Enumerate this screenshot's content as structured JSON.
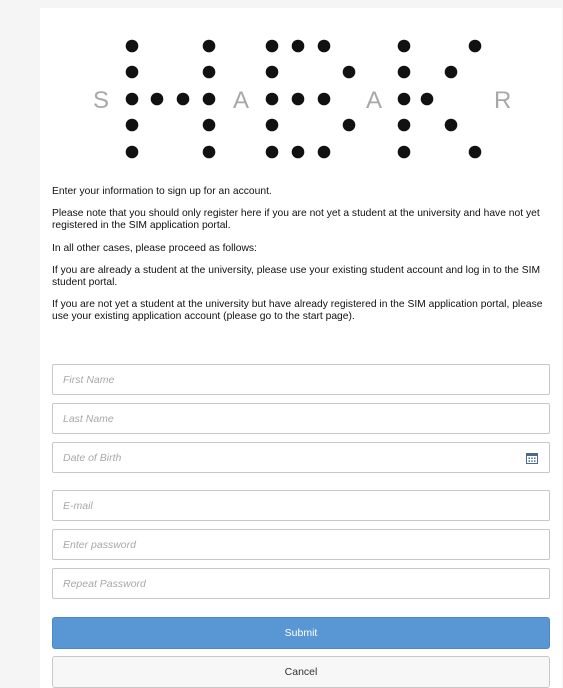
{
  "logo": {
    "letters": [
      "S",
      "A",
      "A",
      "R"
    ]
  },
  "intro": {
    "p1": "Enter your information to sign up for an account.",
    "p2": "Please note that you should only register here if you are not yet a student at the university and have not yet registered in the SIM application portal.",
    "p3": "In all other cases, please proceed as follows:",
    "p4": "If you are already a student at the university, please use your existing student account and log in to the SIM student portal.",
    "p5": "If you are not yet a student at the university but have already registered in the SIM application portal, please use your existing application account (please go to the start page)."
  },
  "form": {
    "first_name_placeholder": "First Name",
    "last_name_placeholder": "Last Name",
    "dob_placeholder": "Date of Birth",
    "email_placeholder": "E-mail",
    "password_placeholder": "Enter password",
    "repeat_password_placeholder": "Repeat Password",
    "submit_label": "Submit",
    "cancel_label": "Cancel",
    "calendar_icon": "calendar-icon"
  },
  "colors": {
    "submit_bg": "#5897d4",
    "border": "#c8c8c8",
    "logo_dot": "#111111",
    "logo_letter": "#a8a8a8"
  }
}
